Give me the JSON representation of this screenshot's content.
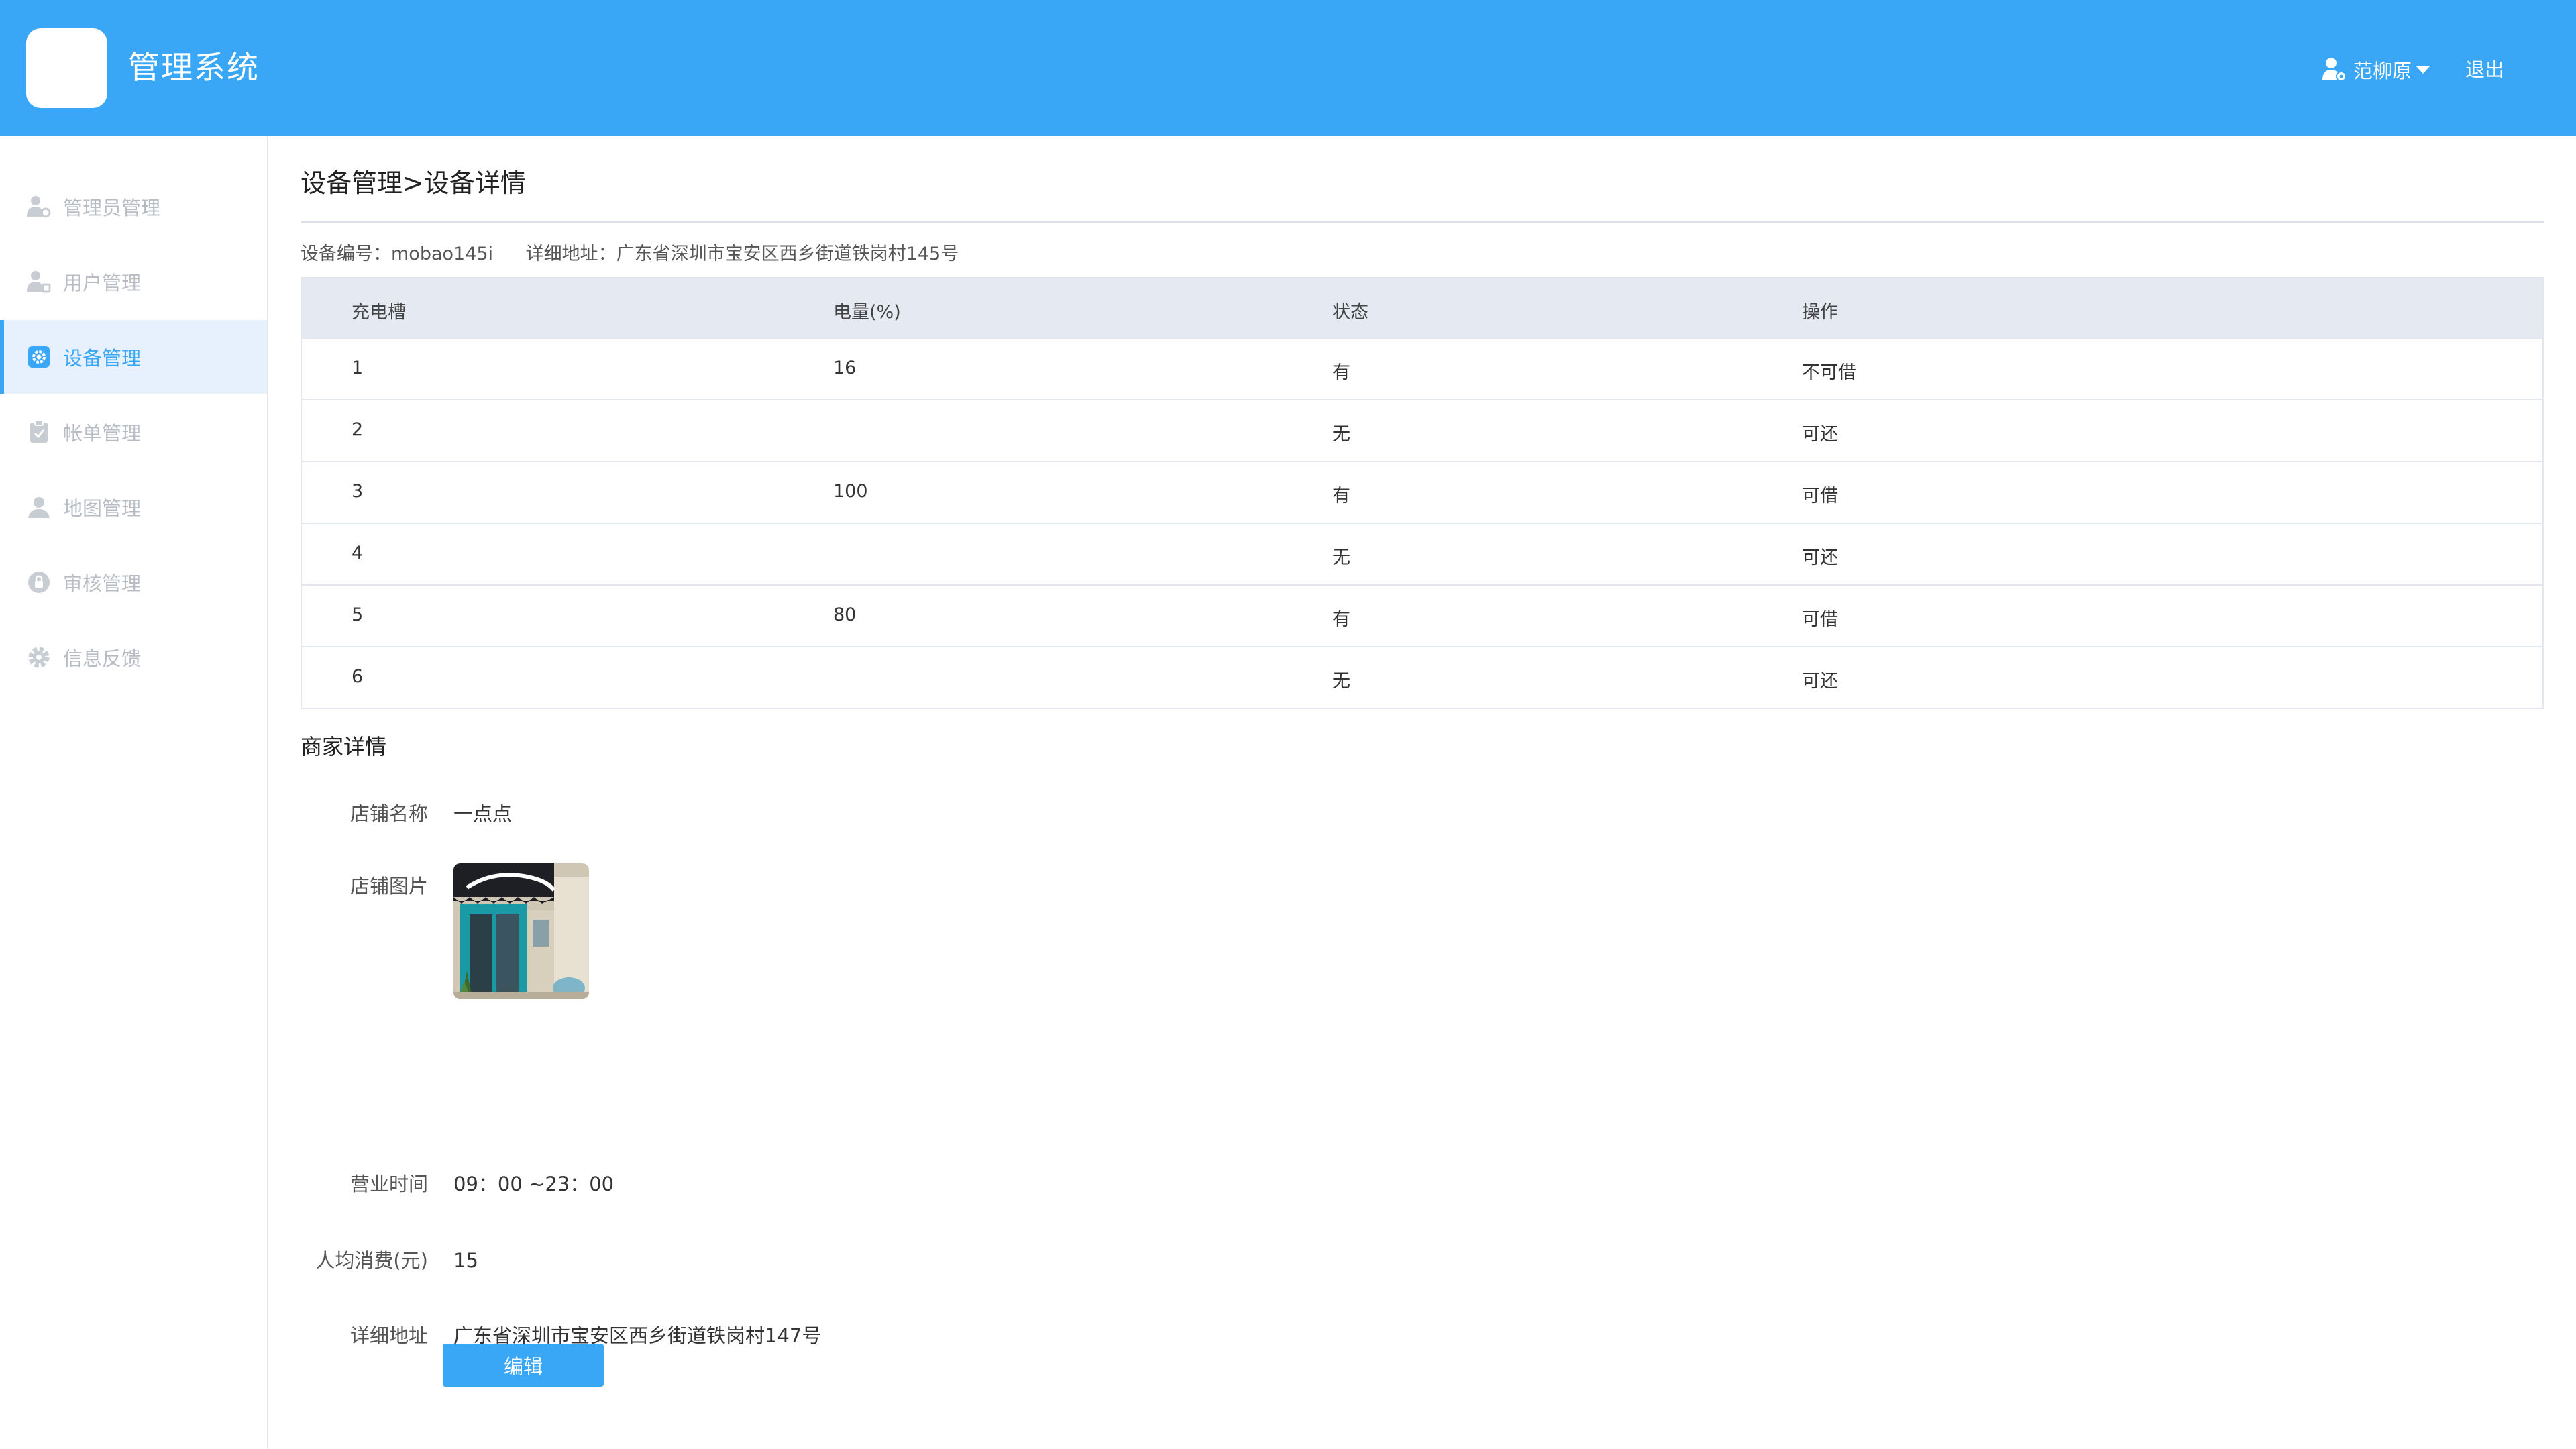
{
  "header": {
    "title": "管理系统",
    "user_name": "范柳原",
    "logout_label": "退出"
  },
  "sidebar": {
    "items": [
      {
        "label": "管理员管理",
        "icon": "admin-user-icon"
      },
      {
        "label": "用户管理",
        "icon": "user-icon"
      },
      {
        "label": "设备管理",
        "icon": "gear-icon",
        "active": true
      },
      {
        "label": "帐单管理",
        "icon": "clipboard-icon"
      },
      {
        "label": "地图管理",
        "icon": "map-pin-icon"
      },
      {
        "label": "审核管理",
        "icon": "review-icon"
      },
      {
        "label": "信息反馈",
        "icon": "feedback-gear-icon"
      }
    ]
  },
  "main": {
    "breadcrumb": "设备管理>设备详情",
    "device_id_text": "设备编号：mobao145i",
    "device_address_text": "详细地址：广东省深圳市宝安区西乡街道铁岗村145号",
    "table": {
      "headers": [
        "充电槽",
        "电量(%)",
        "状态",
        "操作"
      ],
      "rows": [
        [
          "1",
          "16",
          "有",
          "不可借"
        ],
        [
          "2",
          "",
          "无",
          "可还"
        ],
        [
          "3",
          "100",
          "有",
          "可借"
        ],
        [
          "4",
          "",
          "无",
          "可还"
        ],
        [
          "5",
          "80",
          "有",
          "可借"
        ],
        [
          "6",
          "",
          "无",
          "可还"
        ]
      ]
    },
    "merchant": {
      "section_title": "商家详情",
      "shop_name_label": "店铺名称",
      "shop_name": "一点点",
      "shop_image_label": "店铺图片",
      "hours_label": "营业时间",
      "hours": "09：00 ~23：00",
      "avg_spend_label": "人均消费(元)",
      "avg_spend": "15",
      "address_label": "详细地址",
      "address": "广东省深圳市宝安区西乡街道铁岗村147号",
      "edit_label": "编辑"
    }
  },
  "colors": {
    "accent": "#3aa7f6",
    "sidebar_active_bg": "#e7f1fd",
    "table_header_bg": "#e4e9f2",
    "sidebar_inactive": "#b8bcc4"
  }
}
